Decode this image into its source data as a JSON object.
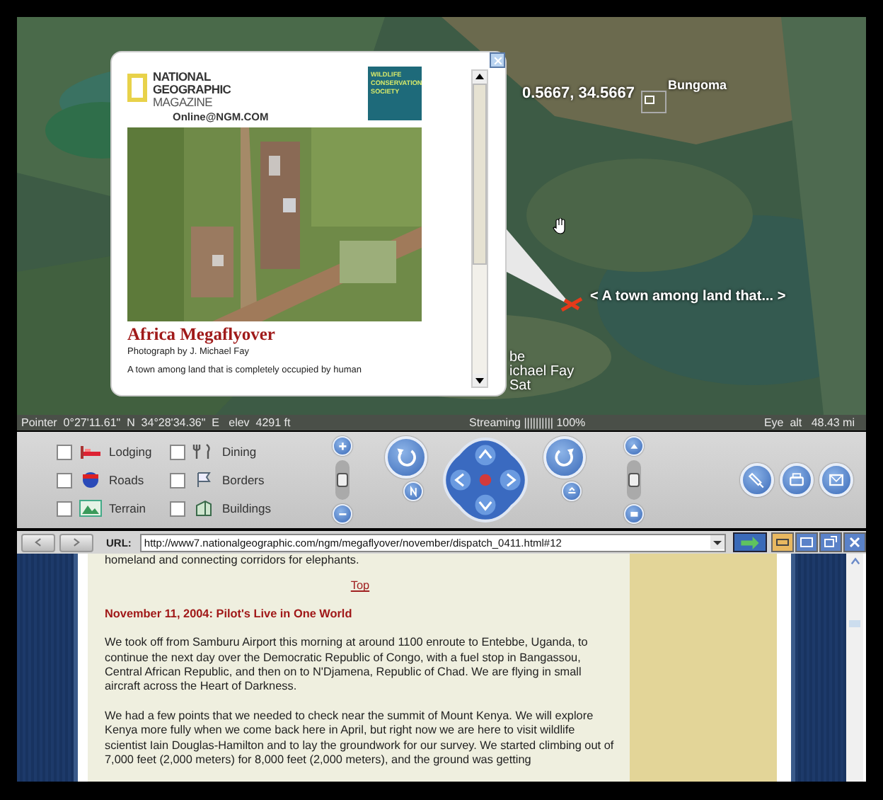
{
  "map": {
    "coordinates": "0.5667, 34.5667",
    "place_label": "Bungoma",
    "placemark_label": "< A town among land that... >",
    "partial_labels": [
      "be",
      "ichael Fay",
      "Sat"
    ]
  },
  "popup": {
    "logo_lines": [
      "NATIONAL",
      "GEOGRAPHIC",
      "MAGAZINE"
    ],
    "site": "Online@NGM.COM",
    "partner_logo_lines": [
      "WILDLIFE",
      "CONSERVATION",
      "SOCIETY"
    ],
    "title": "Africa Megaflyover",
    "credit": "Photograph by J. Michael Fay",
    "text": "A town among land that is completely occupied by human"
  },
  "status_bar": {
    "pointer": "Pointer  0°27'11.61\"  N  34°28'34.36\"  E   elev  4291 ft",
    "streaming": "Streaming |||||||||| 100%",
    "eye_alt": "Eye  alt   48.43 mi"
  },
  "layers": [
    {
      "label": "Lodging",
      "kind": "lodging",
      "checked": false
    },
    {
      "label": "Dining",
      "kind": "dining",
      "checked": false
    },
    {
      "label": "Roads",
      "kind": "roads",
      "checked": false
    },
    {
      "label": "Borders",
      "kind": "borders",
      "checked": false
    },
    {
      "label": "Terrain",
      "kind": "terrain",
      "checked": false
    },
    {
      "label": "Buildings",
      "kind": "buildings",
      "checked": false
    }
  ],
  "zoom_slider": {
    "level": 0.5
  },
  "tilt_slider": {
    "level": 0.5
  },
  "url_bar": {
    "label": "URL:",
    "value": "http://www7.nationalgeographic.com/ngm/megaflyover/november/dispatch_0411.html#12"
  },
  "page": {
    "intro_tail": "homeland and connecting corridors for elephants.",
    "top_link": "Top",
    "heading": "November 11, 2004: Pilot's Live in One World",
    "paragraphs": [
      "We took off from Samburu Airport this morning at around 1100 enroute to Entebbe, Uganda, to continue the next day over the Democratic Republic of Congo, with a fuel stop in Bangassou, Central African Republic, and then on to N'Djamena, Republic of Chad. We are flying in small aircraft across the Heart of Darkness.",
      "We had a few points that we needed to check near the summit of Mount Kenya. We will explore Kenya more fully when we come back here in April, but right now we are here to visit wildlife scientist Iain Douglas-Hamilton and to lay the groundwork for our survey. We started climbing out of 7,000 feet (2,000 meters) for 8,000 feet (2,000 meters), and the ground was getting"
    ]
  }
}
